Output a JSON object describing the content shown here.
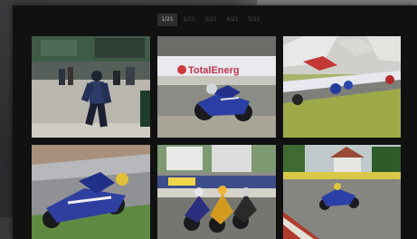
{
  "gallery": {
    "tabs": [
      {
        "label": "1/21"
      },
      {
        "label": "2/21"
      },
      {
        "label": "3/21"
      },
      {
        "label": "4/21"
      },
      {
        "label": "5/21"
      }
    ],
    "sponsor_banner": "TotalEnerg"
  }
}
